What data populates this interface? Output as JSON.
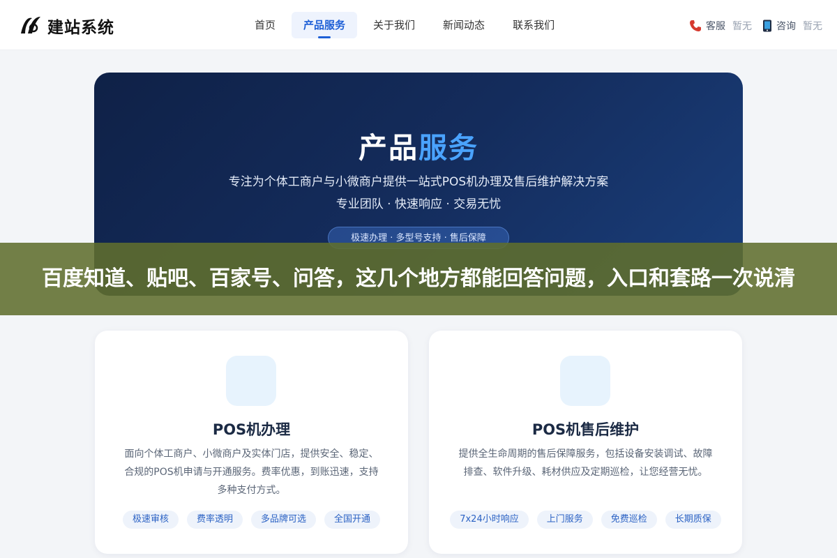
{
  "header": {
    "logo_text": "建站系统",
    "nav": [
      {
        "label": "首页",
        "active": false
      },
      {
        "label": "产品服务",
        "active": true
      },
      {
        "label": "关于我们",
        "active": false
      },
      {
        "label": "新闻动态",
        "active": false
      },
      {
        "label": "联系我们",
        "active": false
      }
    ],
    "contacts": [
      {
        "icon": "phone-icon",
        "label": "客服",
        "value": "暂无"
      },
      {
        "icon": "mobile-icon",
        "label": "咨询",
        "value": "暂无"
      }
    ]
  },
  "hero": {
    "title_main": "产品",
    "title_accent": "服务",
    "subtitle_1": "专注为个体工商户与小微商户提供一站式POS机办理及售后维护解决方案",
    "subtitle_2": "专业团队 · 快速响应 · 交易无忧",
    "pill": "极速办理 · 多型号支持 · 售后保障"
  },
  "banner": {
    "text": "百度知道、贴吧、百家号、问答，这几个地方都能回答问题，入口和套路一次说清"
  },
  "cards": [
    {
      "title": "POS机办理",
      "desc": "面向个体工商户、小微商户及实体门店，提供安全、稳定、合规的POS机申请与开通服务。费率优惠，到账迅速，支持多种支付方式。",
      "tags": [
        "极速审核",
        "费率透明",
        "多品牌可选",
        "全国开通"
      ]
    },
    {
      "title": "POS机售后维护",
      "desc": "提供全生命周期的售后保障服务，包括设备安装调试、故障排查、软件升级、耗材供应及定期巡检，让您经营无忧。",
      "tags": [
        "7x24小时响应",
        "上门服务",
        "免费巡检",
        "长期质保"
      ]
    }
  ],
  "colors": {
    "accent": "#1d5fd6",
    "hero_bg": "#142c5c",
    "hero_accent": "#4aa3ff",
    "banner_bg": "#606e2d"
  }
}
